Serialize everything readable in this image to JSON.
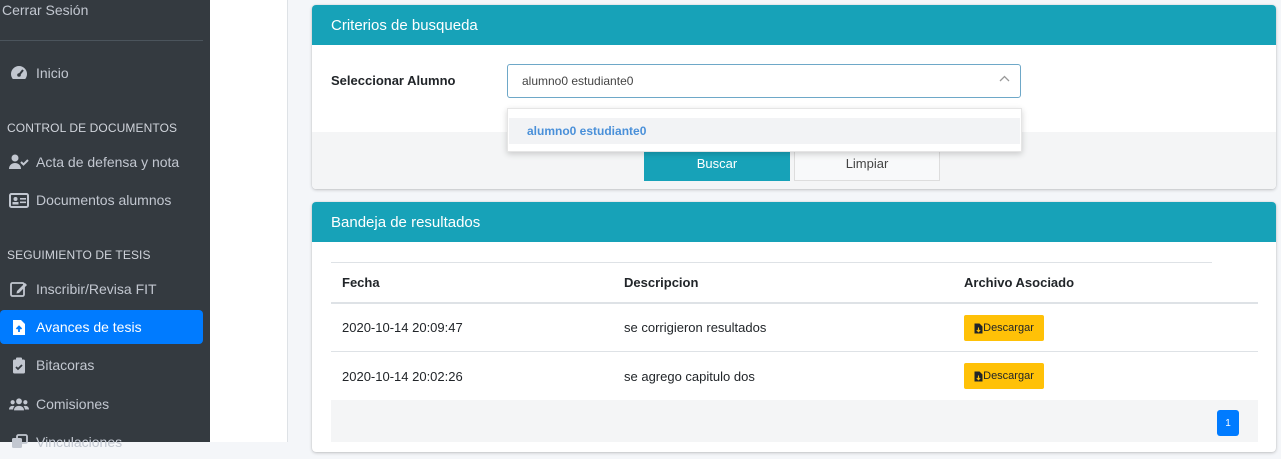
{
  "sidebar": {
    "logout_label": "Cerrar Sesión",
    "items": [
      {
        "label": "Inicio",
        "icon": "tachometer-icon"
      },
      {
        "label": "Acta de defensa y nota",
        "icon": "user-check-icon"
      },
      {
        "label": "Documentos alumnos",
        "icon": "id-card-icon"
      },
      {
        "label": "Inscribir/Revisa FIT",
        "icon": "edit-icon"
      },
      {
        "label": "Avances de tesis",
        "icon": "file-upload-icon"
      },
      {
        "label": "Bitacoras",
        "icon": "clipboard-check-icon"
      },
      {
        "label": "Comisiones",
        "icon": "users-icon"
      },
      {
        "label": "Vinculaciones",
        "icon": "link-icon"
      }
    ],
    "headers": [
      "CONTROL DE DOCUMENTOS",
      "SEGUIMIENTO DE TESIS"
    ],
    "active_color": "#007bff"
  },
  "search": {
    "title": "Criterios de busqueda",
    "student_label": "Seleccionar Alumno",
    "student_value": "alumno0 estudiante0",
    "dropdown_option": "alumno0 estudiante0",
    "search_button": "Buscar",
    "clear_button": "Limpiar"
  },
  "results": {
    "title": "Bandeja de resultados",
    "columns": [
      "Fecha",
      "Descripcion",
      "Archivo Asociado"
    ],
    "rows": [
      {
        "fecha": "2020-10-14 20:09:47",
        "descripcion": "se corrigieron resultados",
        "archivo": "Descargar"
      },
      {
        "fecha": "2020-10-14 20:02:26",
        "descripcion": "se agrego capitulo dos",
        "archivo": "Descargar"
      }
    ],
    "current_page": "1"
  },
  "colors": {
    "header": "#17a2b8",
    "download": "#ffc107"
  }
}
